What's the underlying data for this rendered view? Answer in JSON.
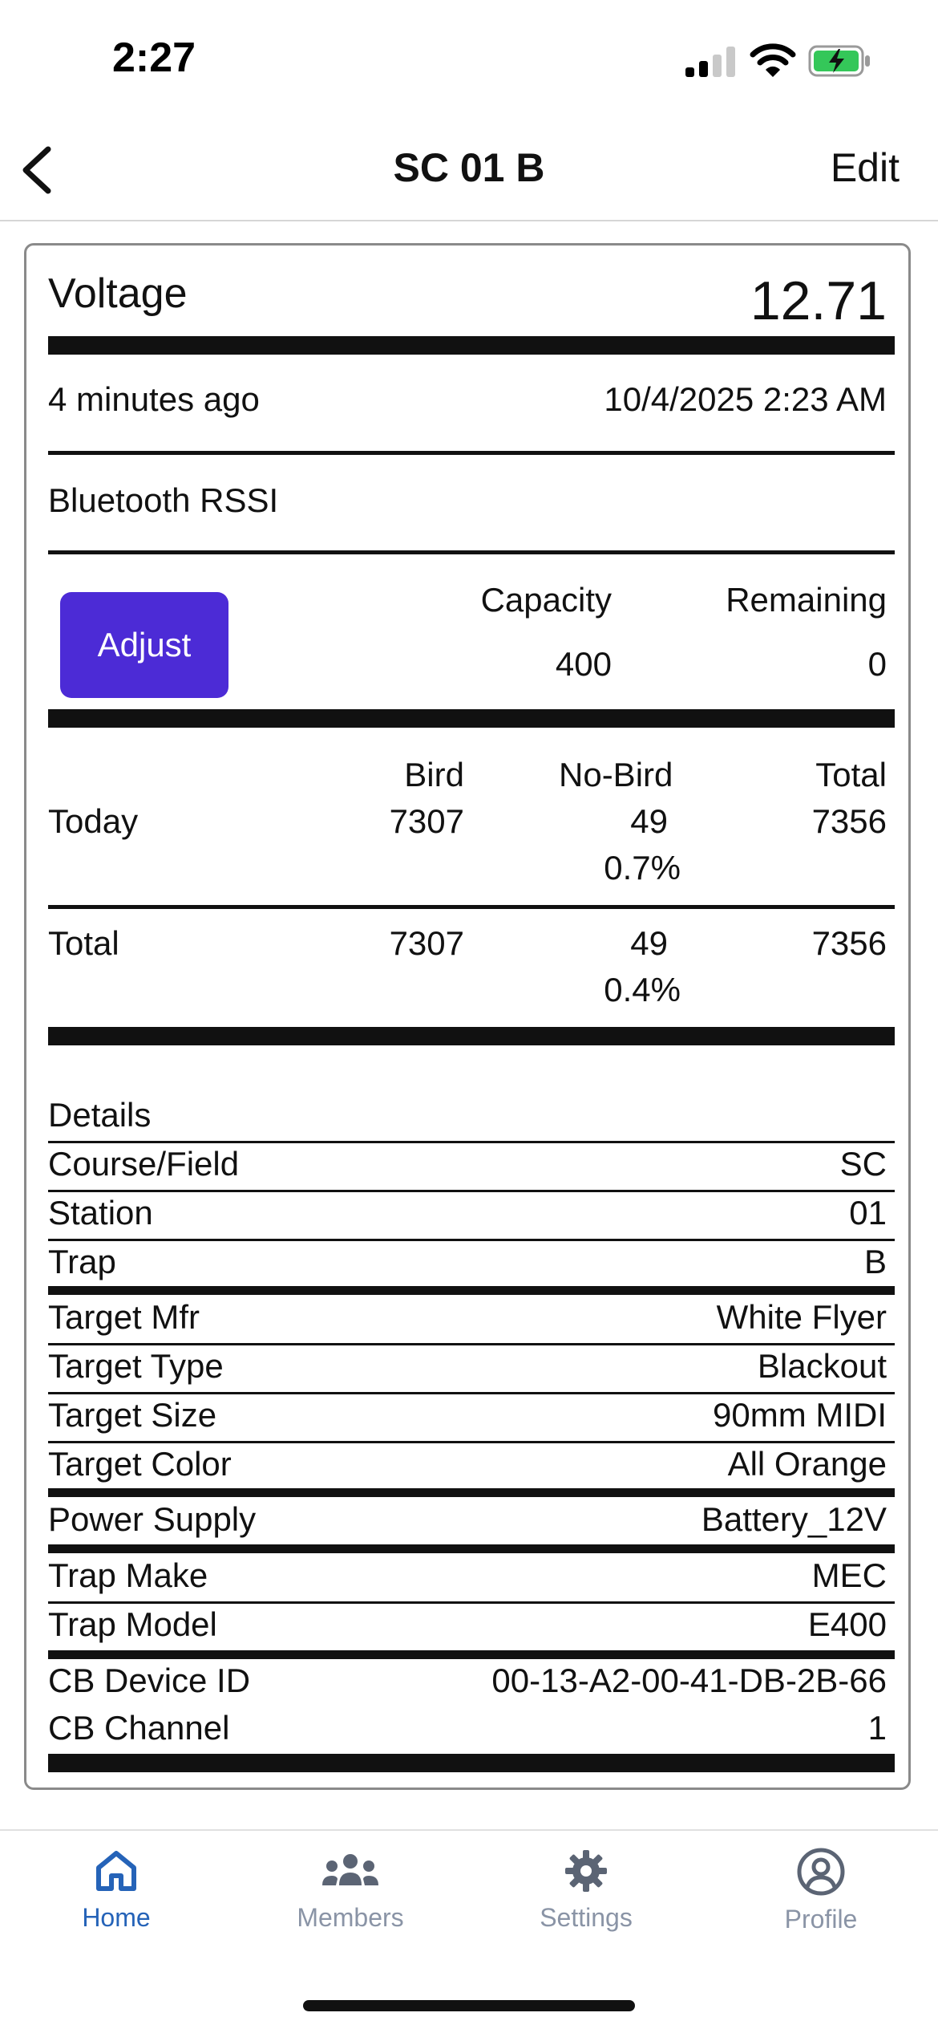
{
  "status_bar": {
    "time": "2:27"
  },
  "nav": {
    "title": "SC 01 B",
    "edit_label": "Edit"
  },
  "voltage": {
    "label": "Voltage",
    "value": "12.71"
  },
  "reading": {
    "ago": "4 minutes ago",
    "timestamp": "10/4/2025 2:23 AM"
  },
  "bluetooth": {
    "label": "Bluetooth RSSI"
  },
  "capacity": {
    "adjust_label": "Adjust",
    "capacity_label": "Capacity",
    "remaining_label": "Remaining",
    "capacity_value": "400",
    "remaining_value": "0"
  },
  "counts": {
    "headers": {
      "bird": "Bird",
      "no_bird": "No-Bird",
      "total": "Total"
    },
    "today": {
      "label": "Today",
      "bird": "7307",
      "no_bird": "49",
      "no_bird_pct": "0.7%",
      "total": "7356"
    },
    "total": {
      "label": "Total",
      "bird": "7307",
      "no_bird": "49",
      "no_bird_pct": "0.4%",
      "total": "7356"
    }
  },
  "details": {
    "title": "Details",
    "rows": [
      {
        "label": "Course/Field",
        "value": "SC"
      },
      {
        "label": "Station",
        "value": "01"
      },
      {
        "label": "Trap",
        "value": "B"
      },
      {
        "label": "Target Mfr",
        "value": "White Flyer"
      },
      {
        "label": "Target Type",
        "value": "Blackout"
      },
      {
        "label": "Target Size",
        "value": "90mm MIDI"
      },
      {
        "label": "Target Color",
        "value": "All Orange"
      },
      {
        "label": "Power Supply",
        "value": "Battery_12V"
      },
      {
        "label": "Trap Make",
        "value": "MEC"
      },
      {
        "label": "Trap Model",
        "value": "E400"
      },
      {
        "label": "CB Device ID",
        "value": "00-13-A2-00-41-DB-2B-66"
      },
      {
        "label": "CB Channel",
        "value": "1"
      }
    ]
  },
  "tabbar": {
    "active_color": "#2563b8",
    "inactive_color": "#8a94a6",
    "items": [
      {
        "label": "Home",
        "icon": "home-icon"
      },
      {
        "label": "Members",
        "icon": "members-icon"
      },
      {
        "label": "Settings",
        "icon": "gear-icon"
      },
      {
        "label": "Profile",
        "icon": "profile-icon"
      }
    ]
  }
}
